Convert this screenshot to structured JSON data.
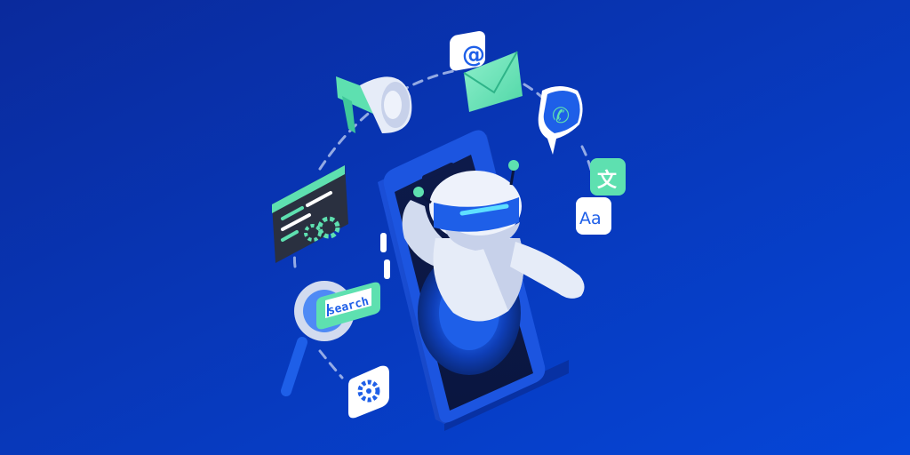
{
  "illustration": {
    "search_text": "search",
    "email_symbol": "@",
    "translate_glyph_top": "文",
    "translate_glyph_bottom": "Aa"
  },
  "colors": {
    "background_top": "#0a2fa8",
    "background_bottom": "#0a3fd0",
    "accent_mint": "#5ee0b0",
    "accent_blue": "#1e5fe8",
    "robot_white": "#e6ecf8",
    "dark_panel": "#2a3040"
  },
  "icons": [
    "megaphone-icon",
    "email-icon",
    "phone-icon",
    "translate-icon",
    "code-settings-icon",
    "search-icon",
    "gear-icon",
    "robot",
    "smartphone"
  ]
}
